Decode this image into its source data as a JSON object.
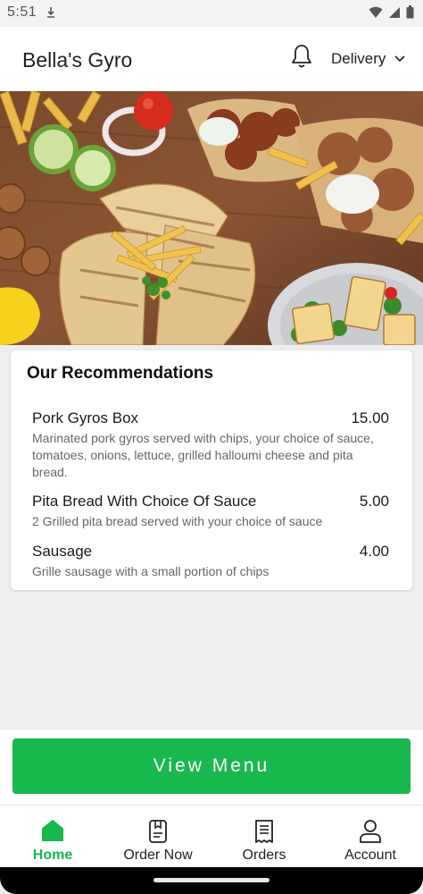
{
  "status": {
    "time": "5:51"
  },
  "header": {
    "title": "Bella's Gyro",
    "mode": "Delivery"
  },
  "recommendations": {
    "title": "Our Recommendations",
    "items": [
      {
        "name": "Pork Gyros Box",
        "price": "15.00",
        "description": "Marinated pork gyros served with chips, your choice of sauce, tomatoes, onions, lettuce, grilled halloumi cheese and pita bread."
      },
      {
        "name": "Pita Bread With Choice Of Sauce",
        "price": "5.00",
        "description": "2 Grilled pita bread served with your choice of sauce"
      },
      {
        "name": "Sausage",
        "price": "4.00",
        "description": "Grille sausage with a small portion of chips"
      }
    ]
  },
  "view_menu_label": "View Menu",
  "nav": [
    {
      "label": "Home",
      "icon": "home-icon",
      "active": true
    },
    {
      "label": "Order Now",
      "icon": "order-icon",
      "active": false
    },
    {
      "label": "Orders",
      "icon": "receipt-icon",
      "active": false
    },
    {
      "label": "Account",
      "icon": "account-icon",
      "active": false
    }
  ],
  "colors": {
    "accent": "#19b84f",
    "background": "#efeeee"
  }
}
